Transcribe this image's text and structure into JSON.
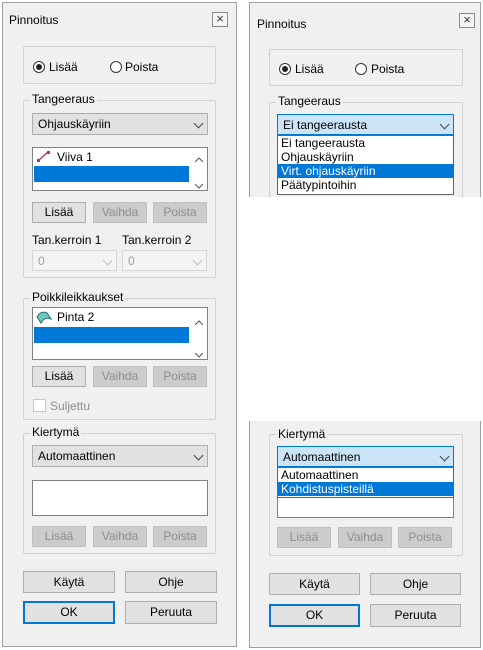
{
  "left": {
    "title": "Pinnoitus",
    "close": "×",
    "mode": {
      "add": "Lisää",
      "remove": "Poista"
    },
    "tangent": {
      "label": "Tangeeraus",
      "combo_value": "Ohjauskäyriin",
      "list_item": "Viiva 1",
      "buttons": {
        "add": "Lisää",
        "change": "Vaihda",
        "remove": "Poista"
      },
      "coef1_label": "Tan.kerroin 1",
      "coef2_label": "Tan.kerroin 2",
      "coef1_value": "0",
      "coef2_value": "0"
    },
    "sections": {
      "label": "Poikkileikkaukset",
      "list_item": "Pinta 2",
      "buttons": {
        "add": "Lisää",
        "change": "Vaihda",
        "remove": "Poista"
      },
      "closed_label": "Suljettu"
    },
    "rotation": {
      "label": "Kiertymä",
      "combo_value": "Automaattinen",
      "buttons": {
        "add": "Lisää",
        "change": "Vaihda",
        "remove": "Poista"
      }
    },
    "footer": {
      "apply": "Käytä",
      "help": "Ohje",
      "ok": "OK",
      "cancel": "Peruuta"
    }
  },
  "right": {
    "title": "Pinnoitus",
    "close": "×",
    "mode": {
      "add": "Lisää",
      "remove": "Poista"
    },
    "tangent": {
      "label": "Tangeeraus",
      "combo_value": "Ei tangeerausta",
      "options": [
        "Ei tangeerausta",
        "Ohjauskäyriin",
        "Virt. ohjauskäyriin",
        "Päätypintoihin"
      ],
      "highlighted": "Virt. ohjauskäyriin"
    },
    "rotation": {
      "label": "Kiertymä",
      "combo_value": "Automaattinen",
      "options": [
        "Automaattinen",
        "Kohdistuspisteillä"
      ],
      "highlighted": "Kohdistuspisteillä",
      "buttons": {
        "add": "Lisää",
        "change": "Vaihda",
        "remove": "Poista"
      }
    },
    "footer": {
      "apply": "Käytä",
      "help": "Ohje",
      "ok": "OK",
      "cancel": "Peruuta"
    }
  },
  "colors": {
    "accent": "#0078d7",
    "window_bg": "#f0f0f0"
  },
  "icons": {
    "curve": "curve-icon",
    "surface": "surface-icon"
  }
}
